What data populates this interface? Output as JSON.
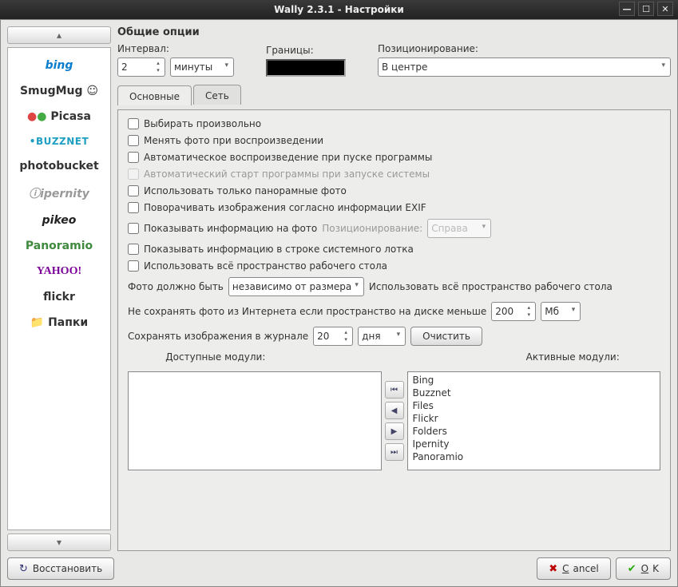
{
  "title": "Wally 2.3.1 - Настройки",
  "sidebar": {
    "items": [
      "bing",
      "SmugMug ☺",
      "Picasa",
      "•BUZZNET",
      "photobucket",
      "ipernity",
      "pikeo",
      "Panoramio",
      "YAHOO!",
      "flickr",
      "Папки"
    ]
  },
  "general": {
    "section_title": "Общие опции",
    "interval_label": "Интервал:",
    "interval_value": "2",
    "interval_unit": "минуты",
    "borders_label": "Границы:",
    "position_label": "Позиционирование:",
    "position_value": "В центре"
  },
  "tabs": {
    "main": "Основные",
    "network": "Сеть"
  },
  "options": {
    "random": "Выбирать произвольно",
    "change_on_play": "Менять фото при воспроизведении",
    "autoplay": "Автоматическое воспроизведение при пуске программы",
    "autostart": "Автоматический старт программы при запуске системы",
    "only_pano": "Использовать только панорамные фото",
    "rotate_exif": "Поворачивать изображения согласно информации EXIF",
    "show_info": "Показывать информацию на фото",
    "info_pos_label": "Позиционирование:",
    "info_pos_value": "Справа",
    "show_tray": "Показывать информацию в строке системного лотка",
    "full_desktop": "Использовать всё пространство рабочего стола",
    "photo_must_label": "Фото должно быть",
    "photo_must_value": "независимо от размера",
    "photo_must_suffix": "Использовать всё пространство рабочего стола",
    "disk_label": "Не сохранять фото из Интернета если пространство на диске меньше",
    "disk_value": "200",
    "disk_unit": "Мб",
    "history_label": "Сохранять изображения в журнале",
    "history_value": "20",
    "history_unit": "дня",
    "clear_btn": "Очистить"
  },
  "modules": {
    "available_label": "Доступные модули:",
    "active_label": "Активные модули:",
    "active": [
      "Bing",
      "Buzznet",
      "Files",
      "Flickr",
      "Folders",
      "Ipernity",
      "Panoramio"
    ]
  },
  "footer": {
    "restore": "Восстановить",
    "cancel": "Cancel",
    "ok": "OK"
  }
}
